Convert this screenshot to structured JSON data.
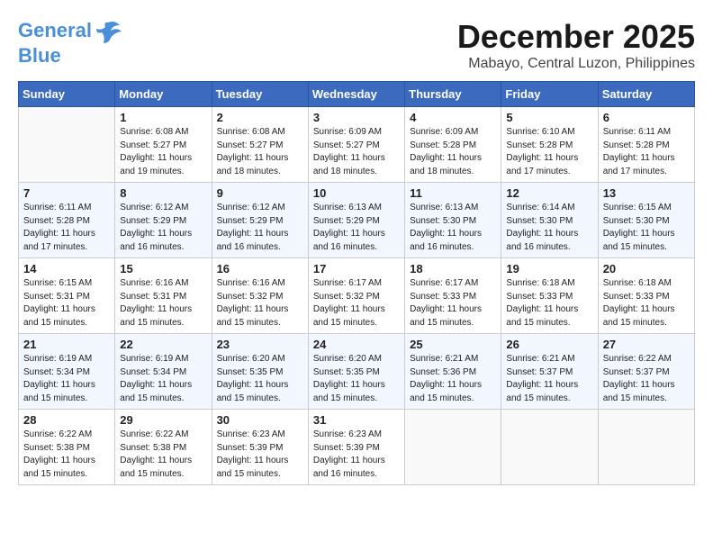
{
  "header": {
    "logo_line1": "General",
    "logo_line2": "Blue",
    "month": "December 2025",
    "location": "Mabayo, Central Luzon, Philippines"
  },
  "weekdays": [
    "Sunday",
    "Monday",
    "Tuesday",
    "Wednesday",
    "Thursday",
    "Friday",
    "Saturday"
  ],
  "weeks": [
    [
      {
        "day": "",
        "info": ""
      },
      {
        "day": "1",
        "info": "Sunrise: 6:08 AM\nSunset: 5:27 PM\nDaylight: 11 hours\nand 19 minutes."
      },
      {
        "day": "2",
        "info": "Sunrise: 6:08 AM\nSunset: 5:27 PM\nDaylight: 11 hours\nand 18 minutes."
      },
      {
        "day": "3",
        "info": "Sunrise: 6:09 AM\nSunset: 5:27 PM\nDaylight: 11 hours\nand 18 minutes."
      },
      {
        "day": "4",
        "info": "Sunrise: 6:09 AM\nSunset: 5:28 PM\nDaylight: 11 hours\nand 18 minutes."
      },
      {
        "day": "5",
        "info": "Sunrise: 6:10 AM\nSunset: 5:28 PM\nDaylight: 11 hours\nand 17 minutes."
      },
      {
        "day": "6",
        "info": "Sunrise: 6:11 AM\nSunset: 5:28 PM\nDaylight: 11 hours\nand 17 minutes."
      }
    ],
    [
      {
        "day": "7",
        "info": "Sunrise: 6:11 AM\nSunset: 5:28 PM\nDaylight: 11 hours\nand 17 minutes."
      },
      {
        "day": "8",
        "info": "Sunrise: 6:12 AM\nSunset: 5:29 PM\nDaylight: 11 hours\nand 16 minutes."
      },
      {
        "day": "9",
        "info": "Sunrise: 6:12 AM\nSunset: 5:29 PM\nDaylight: 11 hours\nand 16 minutes."
      },
      {
        "day": "10",
        "info": "Sunrise: 6:13 AM\nSunset: 5:29 PM\nDaylight: 11 hours\nand 16 minutes."
      },
      {
        "day": "11",
        "info": "Sunrise: 6:13 AM\nSunset: 5:30 PM\nDaylight: 11 hours\nand 16 minutes."
      },
      {
        "day": "12",
        "info": "Sunrise: 6:14 AM\nSunset: 5:30 PM\nDaylight: 11 hours\nand 16 minutes."
      },
      {
        "day": "13",
        "info": "Sunrise: 6:15 AM\nSunset: 5:30 PM\nDaylight: 11 hours\nand 15 minutes."
      }
    ],
    [
      {
        "day": "14",
        "info": "Sunrise: 6:15 AM\nSunset: 5:31 PM\nDaylight: 11 hours\nand 15 minutes."
      },
      {
        "day": "15",
        "info": "Sunrise: 6:16 AM\nSunset: 5:31 PM\nDaylight: 11 hours\nand 15 minutes."
      },
      {
        "day": "16",
        "info": "Sunrise: 6:16 AM\nSunset: 5:32 PM\nDaylight: 11 hours\nand 15 minutes."
      },
      {
        "day": "17",
        "info": "Sunrise: 6:17 AM\nSunset: 5:32 PM\nDaylight: 11 hours\nand 15 minutes."
      },
      {
        "day": "18",
        "info": "Sunrise: 6:17 AM\nSunset: 5:33 PM\nDaylight: 11 hours\nand 15 minutes."
      },
      {
        "day": "19",
        "info": "Sunrise: 6:18 AM\nSunset: 5:33 PM\nDaylight: 11 hours\nand 15 minutes."
      },
      {
        "day": "20",
        "info": "Sunrise: 6:18 AM\nSunset: 5:33 PM\nDaylight: 11 hours\nand 15 minutes."
      }
    ],
    [
      {
        "day": "21",
        "info": "Sunrise: 6:19 AM\nSunset: 5:34 PM\nDaylight: 11 hours\nand 15 minutes."
      },
      {
        "day": "22",
        "info": "Sunrise: 6:19 AM\nSunset: 5:34 PM\nDaylight: 11 hours\nand 15 minutes."
      },
      {
        "day": "23",
        "info": "Sunrise: 6:20 AM\nSunset: 5:35 PM\nDaylight: 11 hours\nand 15 minutes."
      },
      {
        "day": "24",
        "info": "Sunrise: 6:20 AM\nSunset: 5:35 PM\nDaylight: 11 hours\nand 15 minutes."
      },
      {
        "day": "25",
        "info": "Sunrise: 6:21 AM\nSunset: 5:36 PM\nDaylight: 11 hours\nand 15 minutes."
      },
      {
        "day": "26",
        "info": "Sunrise: 6:21 AM\nSunset: 5:37 PM\nDaylight: 11 hours\nand 15 minutes."
      },
      {
        "day": "27",
        "info": "Sunrise: 6:22 AM\nSunset: 5:37 PM\nDaylight: 11 hours\nand 15 minutes."
      }
    ],
    [
      {
        "day": "28",
        "info": "Sunrise: 6:22 AM\nSunset: 5:38 PM\nDaylight: 11 hours\nand 15 minutes."
      },
      {
        "day": "29",
        "info": "Sunrise: 6:22 AM\nSunset: 5:38 PM\nDaylight: 11 hours\nand 15 minutes."
      },
      {
        "day": "30",
        "info": "Sunrise: 6:23 AM\nSunset: 5:39 PM\nDaylight: 11 hours\nand 15 minutes."
      },
      {
        "day": "31",
        "info": "Sunrise: 6:23 AM\nSunset: 5:39 PM\nDaylight: 11 hours\nand 16 minutes."
      },
      {
        "day": "",
        "info": ""
      },
      {
        "day": "",
        "info": ""
      },
      {
        "day": "",
        "info": ""
      }
    ]
  ]
}
